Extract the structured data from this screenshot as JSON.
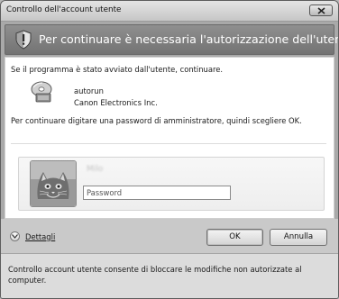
{
  "window": {
    "title": "Controllo dell'account utente"
  },
  "banner": {
    "text": "Per continuare è necessaria l'autorizzazione dell'utente"
  },
  "content": {
    "intro": "Se il programma è stato avviato dall'utente, continuare.",
    "program": {
      "name": "autorun",
      "publisher": "Canon Electronics Inc.",
      "icon": "cd-program-icon"
    },
    "instruction": "Per continuare digitare una password di amministratore, quindi scegliere OK."
  },
  "credentials": {
    "username": "Milo",
    "password_placeholder": "Password",
    "password_value": ""
  },
  "footer": {
    "details_label": "Dettagli",
    "ok_label": "OK",
    "cancel_label": "Annulla"
  },
  "bottom": {
    "text": "Controllo account utente consente di bloccare le modifiche non autorizzate al computer."
  },
  "colors": {
    "banner": "#7f7f7f",
    "content_bg": "#ffffff",
    "footer_bg": "#c9c9c9",
    "bottom_bg": "#dcdcdc"
  }
}
